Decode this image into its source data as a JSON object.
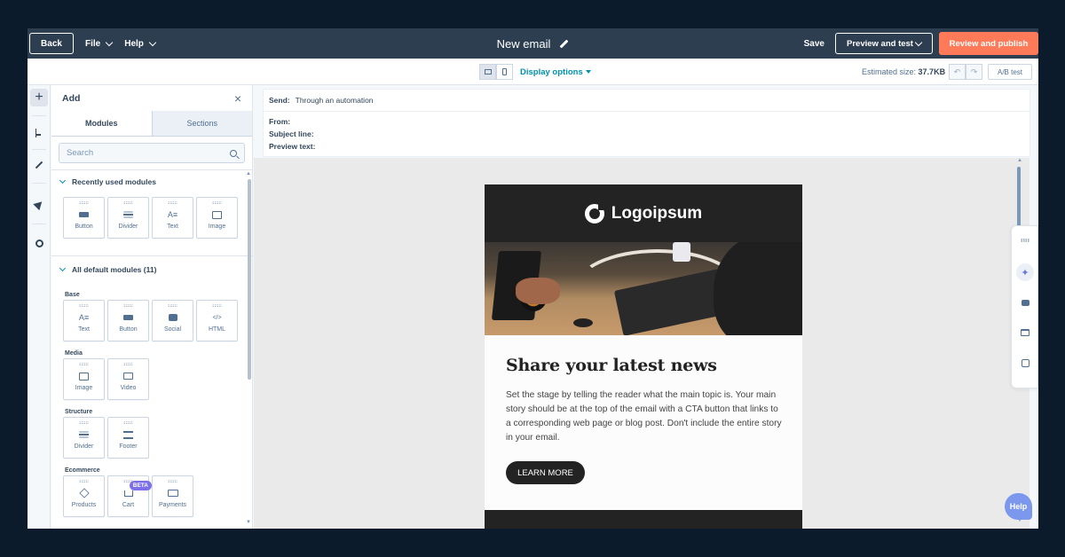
{
  "topbar": {
    "back_label": "Back",
    "file_label": "File",
    "help_label": "Help",
    "title": "New email",
    "save_label": "Save",
    "preview_label": "Preview and test",
    "publish_label": "Review and publish",
    "publish_color": "#ff7a59"
  },
  "toolbar": {
    "display_options_label": "Display options",
    "estimated_size_label": "Estimated size:",
    "estimated_size_value": "37.7KB",
    "undo_icon": "↶",
    "redo_icon": "↷",
    "ab_test_label": "A/B test"
  },
  "rail": {
    "add_icon": "+"
  },
  "panel": {
    "title": "Add",
    "close_icon": "×",
    "tabs": [
      "Modules",
      "Sections"
    ],
    "search_placeholder": "Search",
    "recent_heading": "Recently used modules",
    "recent_items": [
      "Button",
      "Divider",
      "Text",
      "Image"
    ],
    "all_heading": "All default modules (11)",
    "groups": {
      "base": {
        "label": "Base",
        "items": [
          "Text",
          "Button",
          "Social",
          "HTML"
        ]
      },
      "media": {
        "label": "Media",
        "items": [
          "Image",
          "Video"
        ]
      },
      "structure": {
        "label": "Structure",
        "items": [
          "Divider",
          "Footer"
        ]
      },
      "ecommerce": {
        "label": "Ecommerce",
        "items": [
          "Products",
          "Cart",
          "Payments"
        ],
        "beta_label": "BETA"
      }
    },
    "icon_text": "A≡",
    "icon_html": "</>"
  },
  "email_meta": {
    "send_label": "Send:",
    "send_value": "Through an automation",
    "from_label": "From:",
    "subject_label": "Subject line:",
    "preview_label": "Preview text:"
  },
  "email": {
    "logo_text": "Logoipsum",
    "heading": "Share your latest news",
    "body": "Set the stage by telling the reader what the main topic is. Your main story should be at the top of the email with a CTA button that links to a corresponding web page or blog post. Don't include the entire story in your email.",
    "cta_label": "LEARN MORE"
  },
  "floating": {
    "ai_icon": "✦",
    "help_label": "Help"
  }
}
